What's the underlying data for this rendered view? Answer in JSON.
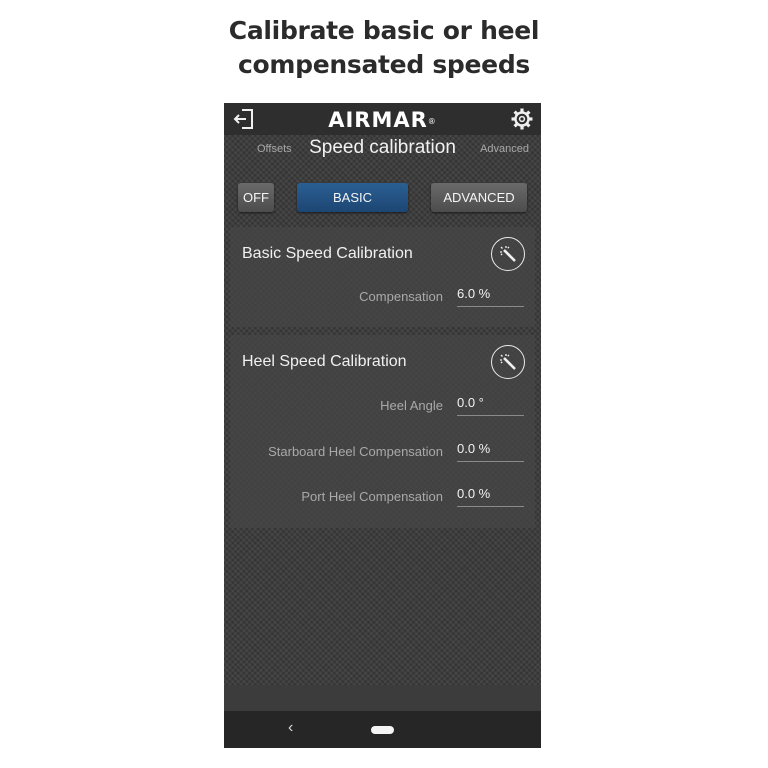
{
  "caption": {
    "line1": "Calibrate basic or heel",
    "line2": "compensated speeds"
  },
  "app": {
    "logo": "AIRMAR",
    "logo_mark": "®",
    "exit_icon": "exit-icon",
    "settings_icon": "gear-icon"
  },
  "nav": {
    "left": "Offsets",
    "title": "Speed calibration",
    "right": "Advanced"
  },
  "modes": {
    "off": "OFF",
    "basic": "BASIC",
    "advanced": "ADVANCED",
    "selected": "BASIC",
    "selected_color": "#1d4673"
  },
  "basic": {
    "title": "Basic Speed Calibration",
    "wand_icon": "magic-wand-icon",
    "fields": [
      {
        "label": "Compensation",
        "value": "6.0 %"
      }
    ]
  },
  "heel": {
    "title": "Heel Speed Calibration",
    "wand_icon": "magic-wand-icon",
    "fields": [
      {
        "label": "Heel Angle",
        "value": "0.0 °"
      },
      {
        "label": "Starboard Heel Compensation",
        "value": "0.0 %"
      },
      {
        "label": "Port Heel Compensation",
        "value": "0.0 %"
      }
    ]
  },
  "system_nav": {
    "back": "‹"
  }
}
